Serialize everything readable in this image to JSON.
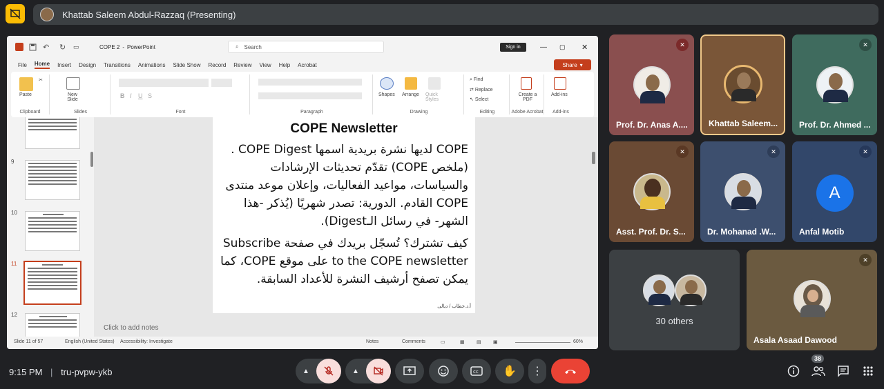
{
  "presenting": {
    "label": "Khattab Saleem Abdul-Razzaq (Presenting)"
  },
  "powerpoint": {
    "doc_title": "COPE 2",
    "app_name": "PowerPoint",
    "search_placeholder": "Search",
    "signin_label": "Sign in",
    "share_label": "Share",
    "menu": [
      "File",
      "Home",
      "Insert",
      "Design",
      "Transitions",
      "Animations",
      "Slide Show",
      "Record",
      "Review",
      "View",
      "Help",
      "Acrobat"
    ],
    "ribbon": {
      "paste": "Paste",
      "clipboard": "Clipboard",
      "new_slide": "New Slide",
      "slides": "Slides",
      "font": "Font",
      "paragraph": "Paragraph",
      "shapes": "Shapes",
      "arrange": "Arrange",
      "quick_styles": "Quick Styles",
      "drawing": "Drawing",
      "find": "Find",
      "replace": "Replace",
      "select": "Select",
      "editing": "Editing",
      "create_pdf": "Create a PDF",
      "adobe_acrobat": "Adobe Acrobat",
      "addins": "Add-ins",
      "addins_group": "Add-ins"
    },
    "thumb_numbers": [
      "9",
      "10",
      "11",
      "12"
    ],
    "slide": {
      "title": "COPE Newsletter",
      "paragraph1": "COPE لديها نشرة بريدية اسمها COPE Digest . (ملخص COPE) تقدّم تحديثات الإرشادات والسياسات، مواعيد الفعاليات، وإعلان موعد منتدى COPE القادم. الدورية: تصدر شهريًا (يُذكر -هذا الشهر- في رسائل الـDigest).",
      "paragraph2": "كيف تشترك؟ تُسجّل بريدك في صفحة Subscribe to the COPE newsletter على موقع COPE، كما يمكن تصفح أرشيف النشرة للأعداد السابقة.",
      "footer": "أ.د.خطاب / ديالى"
    },
    "notes_placeholder": "Click to add notes",
    "status": {
      "slide": "Slide 11 of 57",
      "language": "English (United States)",
      "accessibility": "Accessibility: Investigate",
      "notes": "Notes",
      "comments": "Comments",
      "zoom": "60%"
    }
  },
  "participants": [
    {
      "name": "Prof. Dr. Anas A...."
    },
    {
      "name": "Khattab Saleem..."
    },
    {
      "name": "Prof. Dr. Ahmed ..."
    },
    {
      "name": "Asst. Prof. Dr. S..."
    },
    {
      "name": "Dr. Mohanad .W..."
    },
    {
      "name": "Anfal Motib",
      "initial": "A"
    },
    {
      "name": "30 others"
    },
    {
      "name": "Asala Asaad Dawood"
    }
  ],
  "bottom": {
    "time": "9:15 PM",
    "separator": "|",
    "meeting_code": "tru-pvpw-ykb",
    "people_count": "38"
  },
  "colors": {
    "accent_red": "#ea4335",
    "muted_pink": "#f9dedc",
    "office_orange": "#c43e1c",
    "avatar_blue": "#1a73e8"
  }
}
